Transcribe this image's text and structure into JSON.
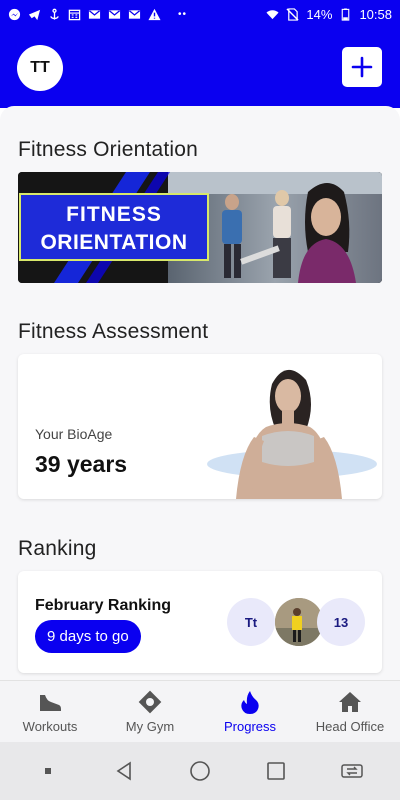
{
  "status_bar": {
    "battery_percent": "14%",
    "time": "10:58",
    "dots": "••"
  },
  "header": {
    "avatar_initials": "TT"
  },
  "sections": {
    "orientation": {
      "title": "Fitness Orientation",
      "banner_line1": "FITNESS",
      "banner_line2": "ORIENTATION"
    },
    "assessment": {
      "title": "Fitness Assessment",
      "bio_label": "Your BioAge",
      "bio_value": "39 years"
    },
    "ranking": {
      "title": "Ranking",
      "card_title": "February Ranking",
      "badge": "9 days to go",
      "user_initials": "Tt",
      "count": "13"
    }
  },
  "bottom_nav": {
    "items": [
      {
        "label": "Workouts",
        "icon": "shoe-icon",
        "active": false
      },
      {
        "label": "My Gym",
        "icon": "gym-location-icon",
        "active": false
      },
      {
        "label": "Progress",
        "icon": "flame-icon",
        "active": true
      },
      {
        "label": "Head Office",
        "icon": "home-icon",
        "active": false
      }
    ]
  },
  "colors": {
    "primary": "#0a00f0",
    "background": "#f7f7f9"
  }
}
